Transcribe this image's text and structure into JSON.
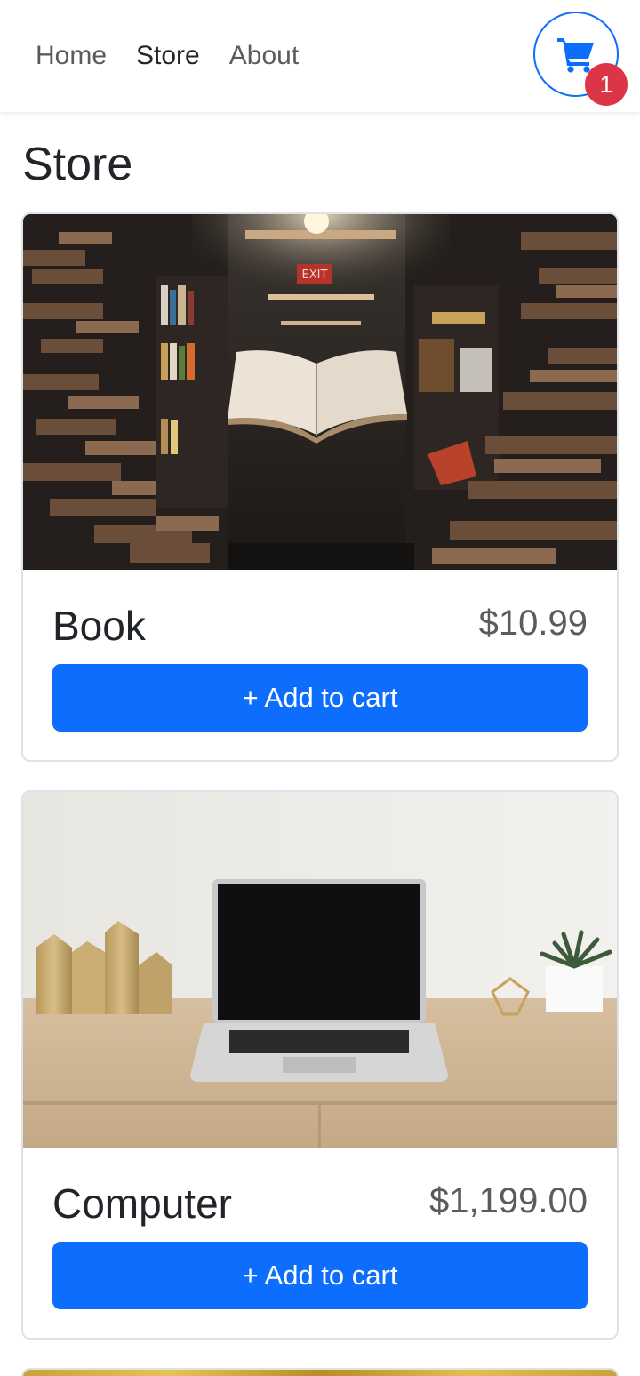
{
  "nav": {
    "links": [
      {
        "label": "Home",
        "active": false
      },
      {
        "label": "Store",
        "active": true
      },
      {
        "label": "About",
        "active": false
      }
    ],
    "cart_count": "1",
    "accent_color": "#0d6efd",
    "badge_color": "#dc3545"
  },
  "page": {
    "title": "Store"
  },
  "items": [
    {
      "name": "Book",
      "price": "$10.99",
      "button_label": "+ Add to cart",
      "image_icon": "floating-book-library-photo"
    },
    {
      "name": "Computer",
      "price": "$1,199.00",
      "button_label": "+ Add to cart",
      "image_icon": "laptop-on-desk-photo"
    }
  ]
}
